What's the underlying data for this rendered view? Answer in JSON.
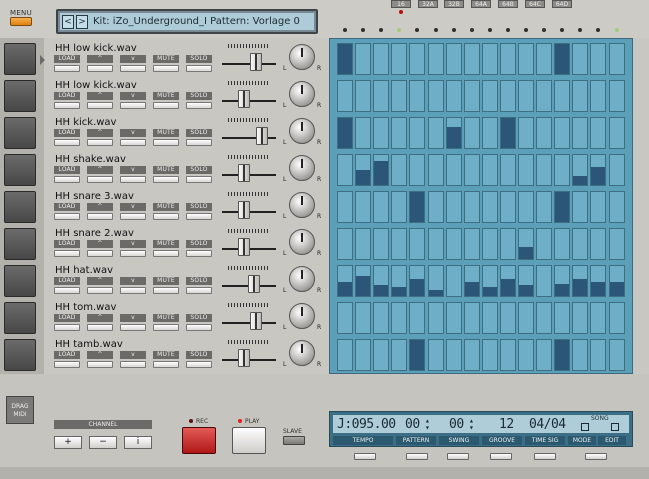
{
  "topbar": {
    "menu_label": "MENU",
    "kit_prev": "<",
    "kit_next": ">",
    "kit_display": "Kit:  iZo_Underground_I  Pattern:  Vorlage 0",
    "banks": [
      "16",
      "32A",
      "32B",
      "64A",
      "64B",
      "64C",
      "64D"
    ]
  },
  "channels": [
    {
      "name": "HH low kick.wav",
      "steps": [
        1,
        0,
        0,
        0,
        0,
        0,
        0,
        0,
        0,
        0,
        0,
        0,
        1,
        0,
        0,
        0
      ],
      "vels": [
        1,
        0,
        0,
        0,
        0,
        0,
        0,
        0,
        0,
        0,
        0,
        0,
        1,
        0,
        0,
        0
      ]
    },
    {
      "name": "HH low kick.wav",
      "steps": [
        0,
        0,
        0,
        0,
        0,
        0,
        0,
        0,
        0,
        0,
        0,
        0,
        0,
        0,
        0,
        0
      ],
      "vels": [
        0,
        0,
        0,
        0,
        0,
        0,
        0,
        0,
        0,
        0,
        0,
        0,
        0,
        0,
        0,
        0
      ]
    },
    {
      "name": "HH kick.wav",
      "steps": [
        1,
        0,
        0,
        0,
        0,
        0,
        1,
        0,
        0,
        1,
        0,
        0,
        0,
        0,
        0,
        0
      ],
      "vels": [
        1,
        0,
        0,
        0,
        0,
        0,
        0.7,
        0,
        0,
        1,
        0,
        0,
        0,
        0,
        0,
        0
      ]
    },
    {
      "name": "HH shake.wav",
      "steps": [
        0,
        1,
        1,
        0,
        0,
        0,
        0,
        0,
        0,
        0,
        0,
        0,
        0,
        1,
        1,
        0
      ],
      "vels": [
        0,
        0.5,
        0.8,
        0,
        0,
        0,
        0,
        0,
        0,
        0,
        0,
        0,
        0,
        0.3,
        0.6,
        0
      ]
    },
    {
      "name": "HH snare 3.wav",
      "steps": [
        0,
        0,
        0,
        0,
        1,
        0,
        0,
        0,
        0,
        0,
        0,
        0,
        1,
        0,
        0,
        0
      ],
      "vels": [
        0,
        0,
        0,
        0,
        1,
        0,
        0,
        0,
        0,
        0,
        0,
        0,
        1,
        0,
        0,
        0
      ]
    },
    {
      "name": "HH snare 2.wav",
      "steps": [
        0,
        0,
        0,
        0,
        0,
        0,
        0,
        0,
        0,
        0,
        1,
        0,
        0,
        0,
        0,
        0
      ],
      "vels": [
        0,
        0,
        0,
        0,
        0,
        0,
        0,
        0,
        0,
        0,
        0.4,
        0,
        0,
        0,
        0,
        0
      ]
    },
    {
      "name": "HH hat.wav",
      "steps": [
        1,
        1,
        1,
        1,
        1,
        1,
        0,
        1,
        1,
        1,
        1,
        0,
        1,
        1,
        1,
        1
      ],
      "vels": [
        0.45,
        0.65,
        0.35,
        0.3,
        0.55,
        0.2,
        0,
        0.45,
        0.3,
        0.55,
        0.35,
        0,
        0.4,
        0.55,
        0.45,
        0.45
      ]
    },
    {
      "name": "HH tom.wav",
      "steps": [
        0,
        0,
        0,
        0,
        0,
        0,
        0,
        0,
        0,
        0,
        0,
        0,
        0,
        0,
        0,
        0
      ],
      "vels": [
        0,
        0,
        0,
        0,
        0,
        0,
        0,
        0,
        0,
        0,
        0,
        0,
        0,
        0,
        0,
        0
      ]
    },
    {
      "name": "HH tamb.wav",
      "steps": [
        0,
        0,
        0,
        0,
        1,
        0,
        0,
        0,
        0,
        0,
        0,
        0,
        1,
        0,
        0,
        0
      ],
      "vels": [
        0,
        0,
        0,
        0,
        1,
        0,
        0,
        0,
        0,
        0,
        0,
        0,
        1,
        0,
        0,
        0
      ]
    }
  ],
  "channel_buttons": {
    "load": "LOAD",
    "up": "^",
    "down": "v",
    "mute": "MUTE",
    "solo": "SOLO"
  },
  "pan": {
    "left": "L",
    "right": "R"
  },
  "bottom": {
    "drag_midi": "DRAG MIDI",
    "channel_label": "CHANNEL",
    "channel_add": "+",
    "channel_remove": "−",
    "channel_info": "i",
    "rec_label": "REC",
    "play_label": "PLAY",
    "slave_label": "SLAVE"
  },
  "sequencer": {
    "tempo": "J:095.00",
    "pattern": "00",
    "swing": "00",
    "groove": "12",
    "time_sig": "04/04",
    "song_label": "SONG",
    "tabs": [
      "TEMPO",
      "PATTERN",
      "SWING",
      "GROOVE",
      "TIME SIG",
      "MODE",
      "EDIT"
    ]
  }
}
